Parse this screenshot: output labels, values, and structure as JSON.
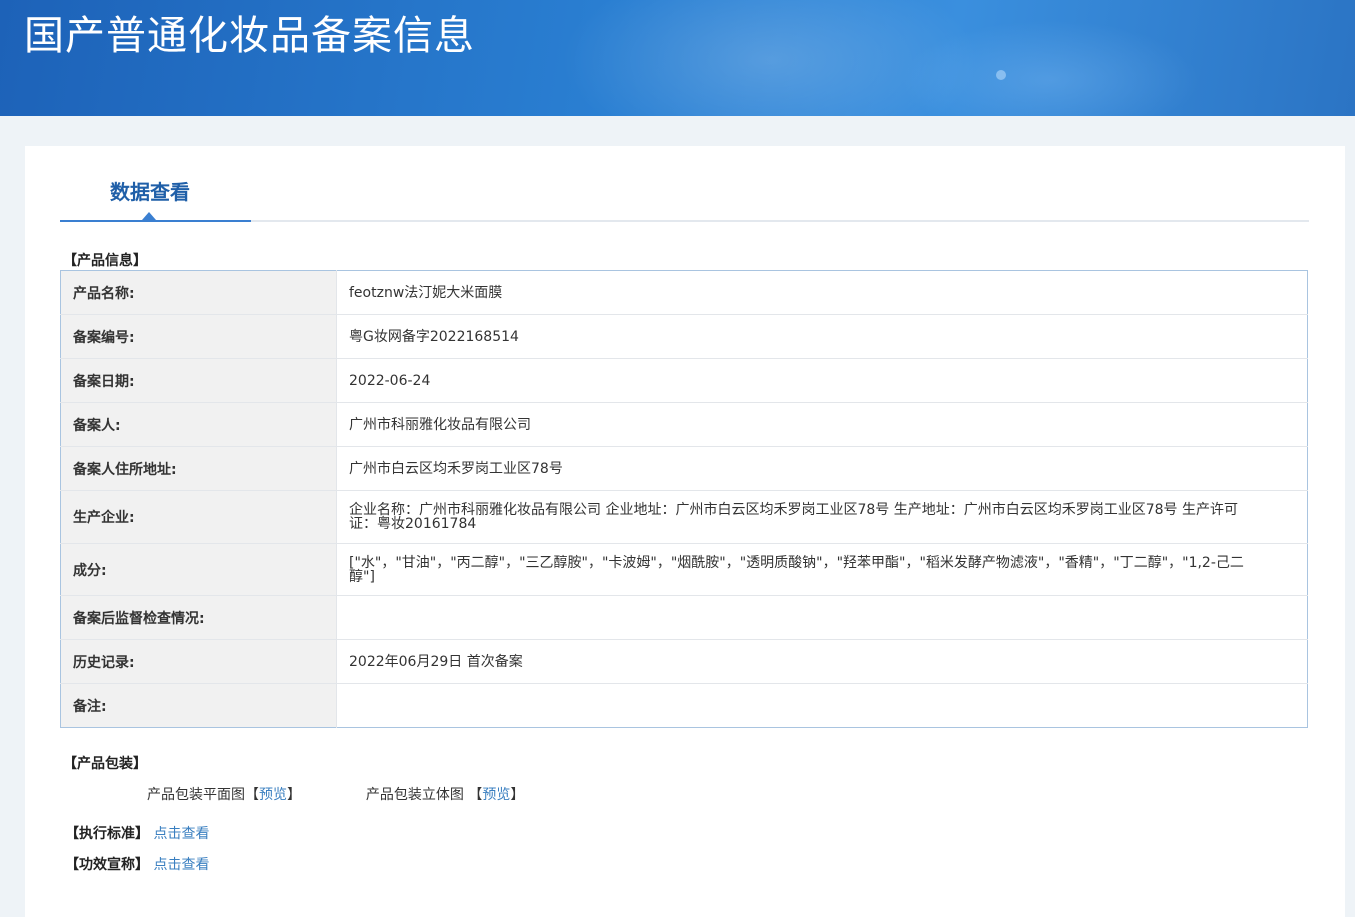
{
  "header": {
    "title": "国产普通化妆品备案信息"
  },
  "tabs": [
    {
      "label": "数据查看",
      "active": true
    }
  ],
  "product_info": {
    "section_label": "【产品信息】",
    "rows": [
      {
        "label": "产品名称:",
        "value": "feotznw法汀妮大米面膜"
      },
      {
        "label": "备案编号:",
        "value": "粤G妆网备字2022168514"
      },
      {
        "label": "备案日期:",
        "value": "2022-06-24"
      },
      {
        "label": "备案人:",
        "value": "广州市科丽雅化妆品有限公司"
      },
      {
        "label": "备案人住所地址:",
        "value": "广州市白云区均禾罗岗工业区78号"
      },
      {
        "label": "生产企业:",
        "value": "企业名称：广州市科丽雅化妆品有限公司 企业地址：广州市白云区均禾罗岗工业区78号 生产地址：广州市白云区均禾罗岗工业区78号 生产许可证：粤妆20161784"
      },
      {
        "label": "成分:",
        "value": "[\"水\"，\"甘油\"，\"丙二醇\"，\"三乙醇胺\"，\"卡波姆\"，\"烟酰胺\"，\"透明质酸钠\"，\"羟苯甲酯\"，\"稻米发酵产物滤液\"，\"香精\"，\"丁二醇\"，\"1,2-己二醇\"]"
      },
      {
        "label": "备案后监督检查情况:",
        "value": ""
      },
      {
        "label": "历史记录:",
        "value": "2022年06月29日 首次备案"
      },
      {
        "label": "备注:",
        "value": ""
      }
    ]
  },
  "packaging": {
    "section_label": "【产品包装】",
    "flat_label": "产品包装平面图",
    "flat_link": "预览",
    "stereo_label": "产品包装立体图",
    "stereo_link": "预览",
    "bracket_open": "【",
    "bracket_close": "】"
  },
  "standard": {
    "label": "【执行标准】",
    "link": "点击查看"
  },
  "efficacy": {
    "label": "【功效宣称】",
    "link": "点击查看"
  }
}
